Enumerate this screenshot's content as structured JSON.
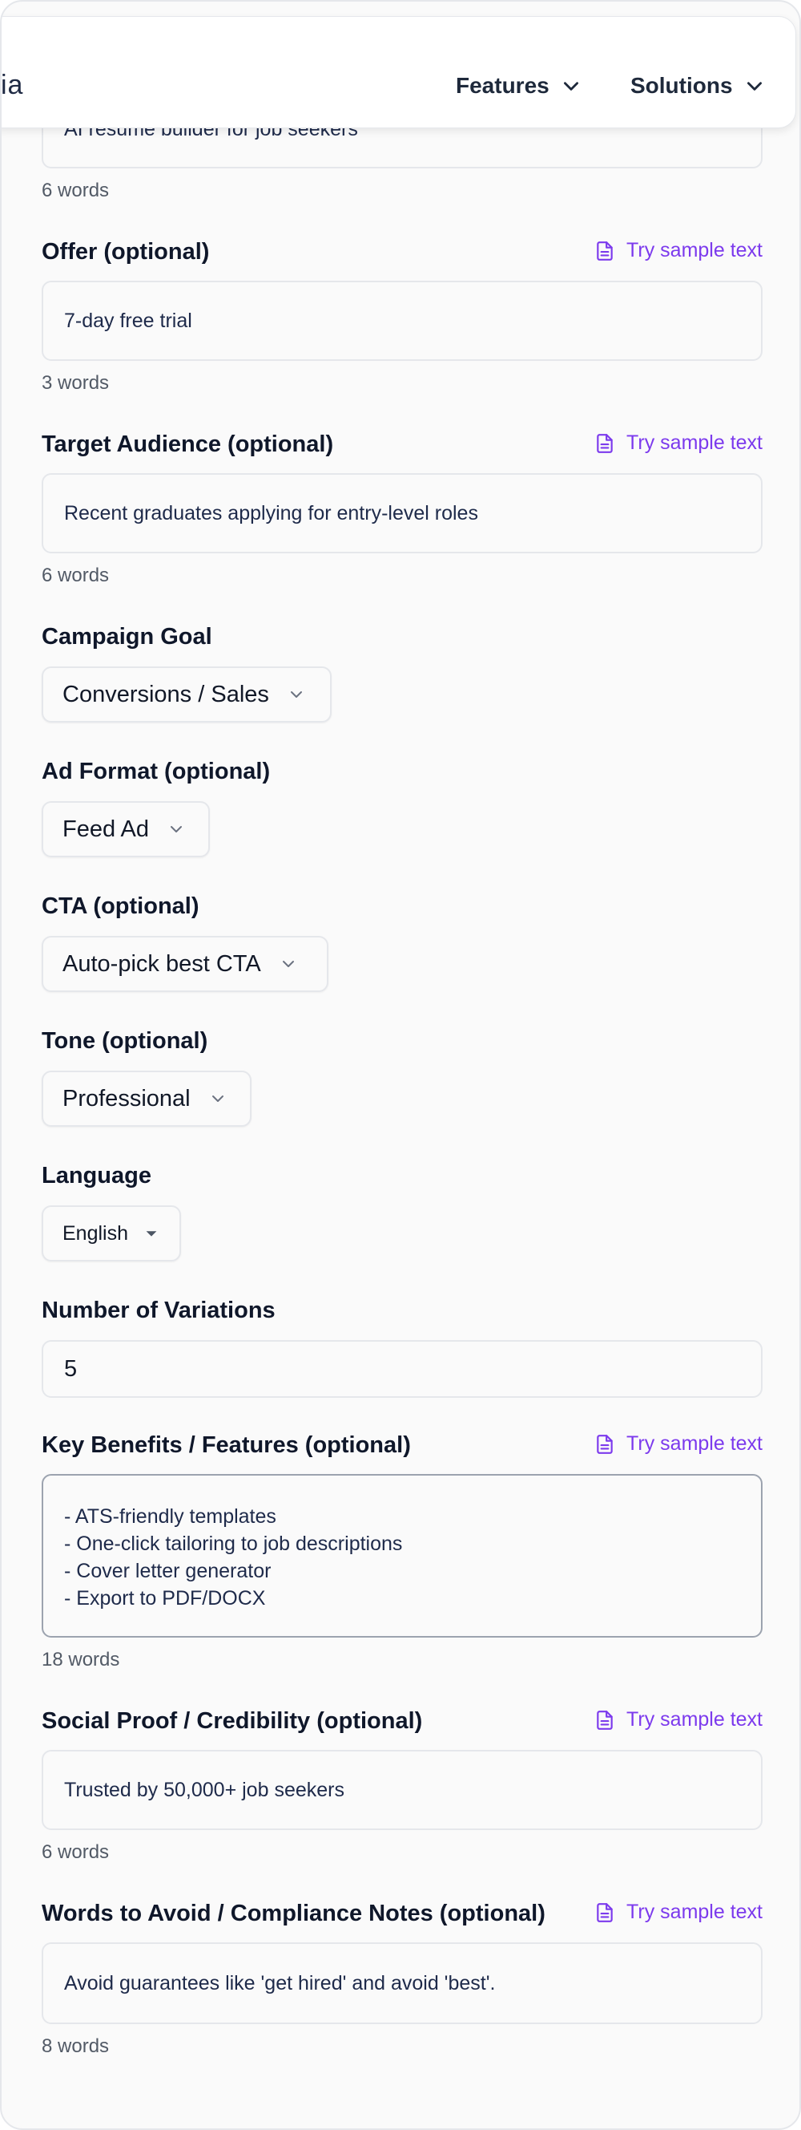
{
  "nav": {
    "logo_fragment": "ia",
    "items": [
      {
        "label": "Features"
      },
      {
        "label": "Solutions"
      }
    ]
  },
  "product": {
    "value": "AI resume builder for job seekers",
    "word_count": "6 words"
  },
  "offer": {
    "label": "Offer (optional)",
    "value": "7-day free trial",
    "word_count": "3 words"
  },
  "audience": {
    "label": "Target Audience (optional)",
    "value": "Recent graduates applying for entry-level roles",
    "word_count": "6 words"
  },
  "goal": {
    "label": "Campaign Goal",
    "selected": "Conversions / Sales"
  },
  "ad_format": {
    "label": "Ad Format (optional)",
    "selected": "Feed Ad"
  },
  "cta": {
    "label": "CTA (optional)",
    "selected": "Auto-pick best CTA"
  },
  "tone": {
    "label": "Tone (optional)",
    "selected": "Professional"
  },
  "language": {
    "label": "Language",
    "selected": "English"
  },
  "variations": {
    "label": "Number of Variations",
    "value": "5"
  },
  "benefits": {
    "label": "Key Benefits / Features (optional)",
    "lines": [
      "- ATS-friendly templates",
      "- One-click tailoring to job descriptions",
      "- Cover letter generator",
      "- Export to PDF/DOCX"
    ],
    "word_count": "18 words"
  },
  "social_proof": {
    "label": "Social Proof / Credibility (optional)",
    "value": "Trusted by 50,000+ job seekers",
    "word_count": "6 words"
  },
  "avoid": {
    "label": "Words to Avoid / Compliance Notes (optional)",
    "value": "Avoid guarantees like 'get hired' and avoid 'best'.",
    "word_count": "8 words"
  },
  "sample_link": "Try sample text",
  "colors": {
    "accent": "#7c3aed",
    "text": "#0f172a",
    "muted": "#525a66"
  }
}
